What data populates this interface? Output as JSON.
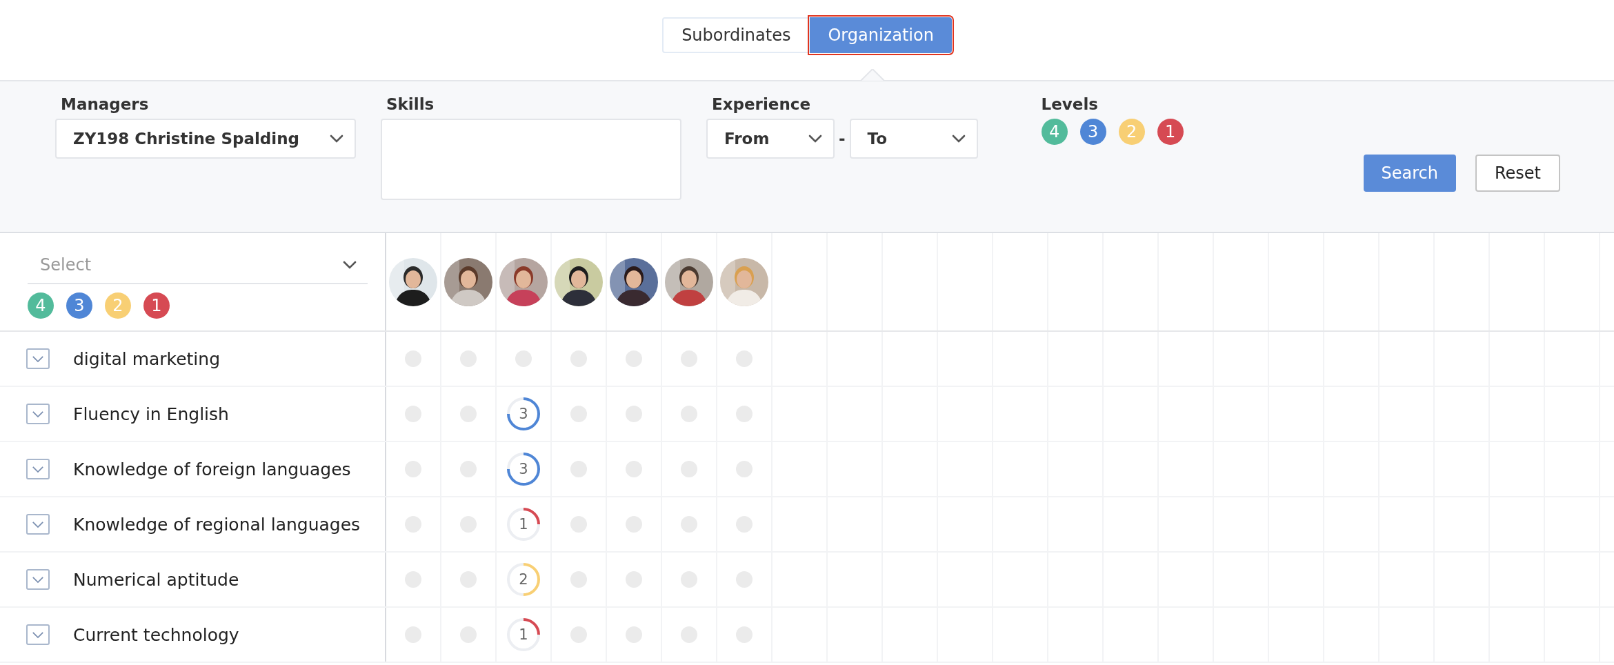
{
  "tabs": [
    {
      "label": "Subordinates",
      "selected": false
    },
    {
      "label": "Organization",
      "selected": true
    }
  ],
  "filters": {
    "managers": {
      "label": "Managers",
      "value": "ZY198 Christine Spalding"
    },
    "skills": {
      "label": "Skills"
    },
    "experience": {
      "label": "Experience",
      "from": "From",
      "separator": "-",
      "to": "To"
    },
    "levels": {
      "label": "Levels",
      "items": [
        {
          "label": "4",
          "color": "#52bb9b"
        },
        {
          "label": "3",
          "color": "#4f86d6"
        },
        {
          "label": "2",
          "color": "#f8cf74"
        },
        {
          "label": "1",
          "color": "#d64a53"
        }
      ]
    },
    "buttons": [
      {
        "label": "Search",
        "kind": "primary"
      },
      {
        "label": "Reset",
        "kind": "secondary"
      }
    ]
  },
  "grid": {
    "select": {
      "placeholder": "Select"
    },
    "legend": [
      {
        "label": "4",
        "color": "#52bb9b"
      },
      {
        "label": "3",
        "color": "#4f86d6"
      },
      {
        "label": "2",
        "color": "#f8cf74"
      },
      {
        "label": "1",
        "color": "#d64a53"
      }
    ],
    "skills": [
      {
        "name": "digital marketing",
        "cells": [
          {
            "kind": "empty"
          },
          {
            "kind": "empty"
          },
          {
            "kind": "empty"
          },
          {
            "kind": "empty"
          },
          {
            "kind": "empty"
          },
          {
            "kind": "empty"
          },
          {
            "kind": "empty"
          }
        ]
      },
      {
        "name": "Fluency in English",
        "cells": [
          {
            "kind": "empty"
          },
          {
            "kind": "empty"
          },
          {
            "kind": "rated",
            "rating": "3",
            "color": "#4f86d6"
          },
          {
            "kind": "empty"
          },
          {
            "kind": "empty"
          },
          {
            "kind": "empty"
          },
          {
            "kind": "empty"
          }
        ]
      },
      {
        "name": "Knowledge of foreign languages",
        "cells": [
          {
            "kind": "empty"
          },
          {
            "kind": "empty"
          },
          {
            "kind": "rated",
            "rating": "3",
            "color": "#4f86d6"
          },
          {
            "kind": "empty"
          },
          {
            "kind": "empty"
          },
          {
            "kind": "empty"
          },
          {
            "kind": "empty"
          }
        ]
      },
      {
        "name": "Knowledge of regional languages",
        "cells": [
          {
            "kind": "empty"
          },
          {
            "kind": "empty"
          },
          {
            "kind": "rated",
            "rating": "1",
            "color": "#d64a53"
          },
          {
            "kind": "empty"
          },
          {
            "kind": "empty"
          },
          {
            "kind": "empty"
          },
          {
            "kind": "empty"
          }
        ]
      },
      {
        "name": "Numerical aptitude",
        "cells": [
          {
            "kind": "empty"
          },
          {
            "kind": "empty"
          },
          {
            "kind": "rated",
            "rating": "2",
            "color": "#f8cf74"
          },
          {
            "kind": "empty"
          },
          {
            "kind": "empty"
          },
          {
            "kind": "empty"
          },
          {
            "kind": "empty"
          }
        ]
      },
      {
        "name": "Current technology",
        "cells": [
          {
            "kind": "empty"
          },
          {
            "kind": "empty"
          },
          {
            "kind": "rated",
            "rating": "1",
            "color": "#d64a53"
          },
          {
            "kind": "empty"
          },
          {
            "kind": "empty"
          },
          {
            "kind": "empty"
          },
          {
            "kind": "empty"
          }
        ]
      }
    ]
  }
}
